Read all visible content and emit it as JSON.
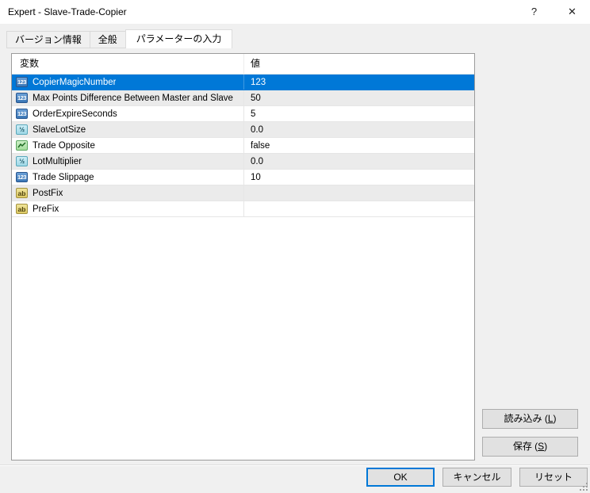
{
  "window": {
    "title": "Expert - Slave-Trade-Copier",
    "help_icon": "?",
    "close_icon": "✕"
  },
  "tabs": [
    {
      "label": "バージョン情報",
      "active": false
    },
    {
      "label": "全般",
      "active": false
    },
    {
      "label": "パラメーターの入力",
      "active": true
    }
  ],
  "table": {
    "columns": [
      "変数",
      "値"
    ],
    "rows": [
      {
        "icon": "int",
        "name": "CopierMagicNumber",
        "value": "123",
        "selected": true
      },
      {
        "icon": "int",
        "name": "Max Points Difference Between Master and Slave",
        "value": "50"
      },
      {
        "icon": "int",
        "name": "OrderExpireSeconds",
        "value": "5"
      },
      {
        "icon": "double",
        "name": "SlaveLotSize",
        "value": "0.0"
      },
      {
        "icon": "bool",
        "name": "Trade Opposite",
        "value": "false"
      },
      {
        "icon": "double",
        "name": "LotMultiplier",
        "value": "0.0"
      },
      {
        "icon": "int",
        "name": "Trade Slippage",
        "value": "10"
      },
      {
        "icon": "string",
        "name": "PostFix",
        "value": ""
      },
      {
        "icon": "string",
        "name": "PreFix",
        "value": ""
      }
    ]
  },
  "icon_glyphs": {
    "int": "123",
    "double": "½",
    "string": "ab"
  },
  "side_buttons": {
    "load": {
      "pre": "読み込み (",
      "key": "L",
      "post": ")"
    },
    "save": {
      "pre": "保存 (",
      "key": "S",
      "post": ")"
    }
  },
  "bottom_buttons": {
    "ok": "OK",
    "cancel": "キャンセル",
    "reset": "リセット"
  },
  "colors": {
    "selection": "#0078d7",
    "accent": "#0078d7",
    "alt_row": "#ebebeb",
    "dialog_bg": "#f0f0f0",
    "titlebar_bg": "#ffffff"
  }
}
